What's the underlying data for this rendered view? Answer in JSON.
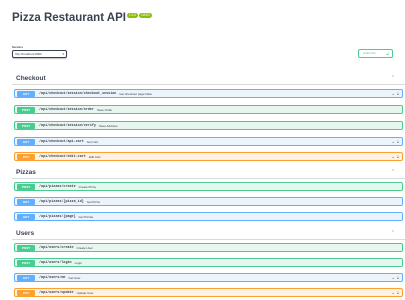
{
  "header": {
    "title": "Pizza Restaurant API",
    "version_badge": "1.0.0",
    "oas_badge": "OAS3"
  },
  "servers": {
    "label": "Servers",
    "selected": "http://localhost:8000"
  },
  "authorize": {
    "label": "Authorize"
  },
  "icons": {
    "chevron": "chevron-icon",
    "lock": "lock-icon"
  },
  "colors": {
    "get": "#61affe",
    "post": "#49cc90",
    "put": "#fca130"
  },
  "sections": [
    {
      "title": "Checkout",
      "operations": [
        {
          "method": "GET",
          "path": "/api/checkout/session/checkout_session",
          "summary": "Get checkout page Data"
        },
        {
          "method": "POST",
          "path": "/api/checkout/session/order",
          "summary": "Save Order"
        },
        {
          "method": "POST",
          "path": "/api/checkout/session/verify",
          "summary": "Save Address"
        },
        {
          "method": "GET",
          "path": "/api/checkout/api-cart",
          "summary": "Get Cart"
        },
        {
          "method": "PUT",
          "path": "/api/checkout/edit-cart",
          "summary": "Edit Cart"
        }
      ]
    },
    {
      "title": "Pizzas",
      "operations": [
        {
          "method": "POST",
          "path": "/api/pizzas/create",
          "summary": "Create Pizza"
        },
        {
          "method": "GET",
          "path": "/api/pizzas/{pizza_id}",
          "summary": "Get Pizza"
        },
        {
          "method": "GET",
          "path": "/api/pizzas/{page}",
          "summary": "Get Pizzas"
        }
      ]
    },
    {
      "title": "Users",
      "operations": [
        {
          "method": "POST",
          "path": "/api/users/create",
          "summary": "Create User"
        },
        {
          "method": "POST",
          "path": "/api/users/login",
          "summary": "Login"
        },
        {
          "method": "GET",
          "path": "/api/users/me",
          "summary": "Get User"
        },
        {
          "method": "PUT",
          "path": "/api/users/update",
          "summary": "Update User"
        }
      ]
    }
  ]
}
